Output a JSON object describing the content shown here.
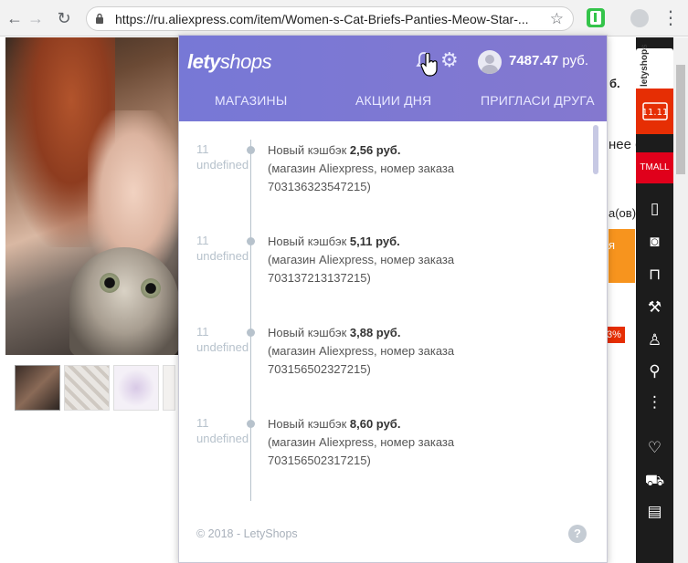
{
  "browser": {
    "back": "←",
    "forward": "→",
    "reload": "↻",
    "url": "https://ru.aliexpress.com/item/Women-s-Cat-Briefs-Panties-Meow-Star-...",
    "star": "☆",
    "menu": "⋮"
  },
  "page_bg": {
    "frag_1": "б.",
    "frag_2": "нее с",
    "frag_3": "а(ов)",
    "frag_4": "я",
    "frag_5": "3%",
    "sidebar_lety": "letyshops",
    "sidebar_tmall": "TMALL"
  },
  "popup": {
    "logo_bold": "lety",
    "logo_light": "shops",
    "balance_amount": "7487.47",
    "balance_currency": "руб.",
    "tabs": [
      "МАГАЗИНЫ",
      "АКЦИИ ДНЯ",
      "ПРИГЛАСИ ДРУГА"
    ],
    "events": [
      {
        "day": "11",
        "month": "undefined",
        "title": "Новый кэшбэк",
        "amount": "2,56 руб.",
        "line2": "(магазин Aliexpress, номер заказа",
        "line3": "703136323547215)"
      },
      {
        "day": "11",
        "month": "undefined",
        "title": "Новый кэшбэк",
        "amount": "5,11 руб.",
        "line2": "(магазин Aliexpress, номер заказа",
        "line3": "703137213137215)"
      },
      {
        "day": "11",
        "month": "undefined",
        "title": "Новый кэшбэк",
        "amount": "3,88 руб.",
        "line2": "(магазин Aliexpress, номер заказа",
        "line3": "703156502327215)"
      },
      {
        "day": "11",
        "month": "undefined",
        "title": "Новый кэшбэк",
        "amount": "8,60 руб.",
        "line2": "(магазин Aliexpress, номер заказа",
        "line3": "703156502317215)"
      }
    ],
    "footer": "© 2018 - LetyShops",
    "help": "?"
  },
  "colors": {
    "header_gradient_start": "#7778d6",
    "header_gradient_end": "#8478cf",
    "timeline": "#b7c2cc",
    "extension_green": "#34c44a"
  },
  "icons": [
    "lock-icon",
    "star-icon",
    "letyshops-extension-icon",
    "profile-icon",
    "bell-icon",
    "gear-icon",
    "avatar-icon",
    "help-icon",
    "hand-cursor-icon"
  ]
}
